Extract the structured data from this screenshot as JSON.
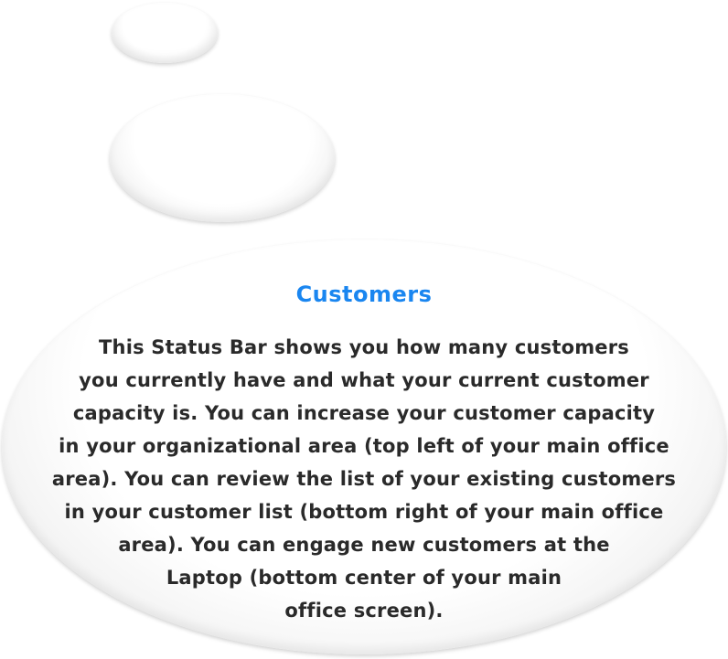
{
  "tooltip": {
    "title": "Customers",
    "lines": [
      "This Status Bar shows you how many customers",
      "you currently have and what your current customer",
      "capacity is. You can increase your customer capacity",
      "in your organizational area (top left of your main office",
      "area). You can review the list of your existing customers",
      "in your customer list (bottom right of your main office",
      "area). You can engage new customers at the",
      "Laptop (bottom center of your main",
      "office screen)."
    ]
  },
  "colors": {
    "title": "#1a86f0",
    "text": "#2a2a2a",
    "bubble": "#ffffff"
  }
}
